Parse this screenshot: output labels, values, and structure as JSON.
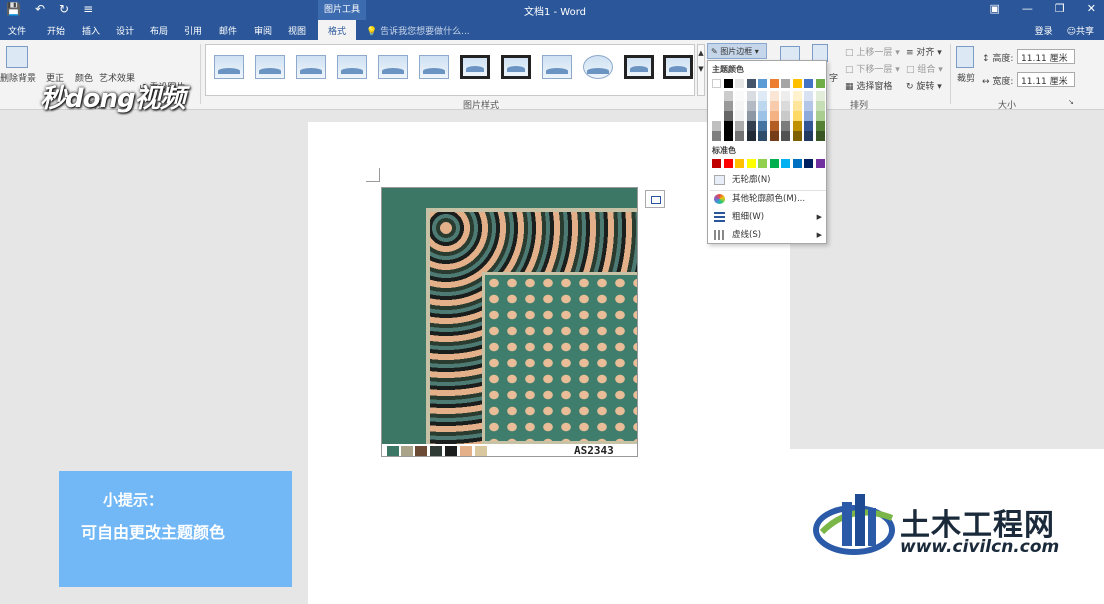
{
  "title_bar": {
    "doc_title": "文档1 - Word",
    "context_tab_group": "图片工具",
    "quick_access": [
      "save-icon",
      "undo-icon",
      "redo-icon",
      "customize-icon"
    ],
    "window_buttons": [
      "ribbon-display-icon",
      "minimize-icon",
      "restore-icon",
      "close-icon"
    ]
  },
  "tabs": [
    {
      "label": "文件"
    },
    {
      "label": "开始"
    },
    {
      "label": "插入"
    },
    {
      "label": "设计"
    },
    {
      "label": "布局"
    },
    {
      "label": "引用"
    },
    {
      "label": "邮件"
    },
    {
      "label": "审阅"
    },
    {
      "label": "视图"
    },
    {
      "label": "格式",
      "active": true
    }
  ],
  "tell_me": "告诉我您想要做什么...",
  "account": {
    "signin": "登录",
    "share": "共享"
  },
  "ribbon": {
    "remove_bg": "删除背景",
    "corrections": "更正",
    "color": "颜色",
    "artistic": "艺术效果",
    "reset_picture": "重设图片",
    "group_adjust": "调整",
    "group_styles": "图片样式",
    "border_button": "图片边框",
    "wrap_text": "字",
    "bring_forward": "上移一层",
    "send_backward": "下移一层",
    "selection_pane": "选择窗格",
    "align": "对齐",
    "group": "组合",
    "rotate": "旋转",
    "group_arrange": "排列",
    "crop": "裁剪",
    "height_label": "高度:",
    "height_value": "11.11 厘米",
    "width_label": "宽度:",
    "width_value": "11.11 厘米",
    "group_size": "大小"
  },
  "watermark_logo": "秒dong视频",
  "dropdown": {
    "theme_colors_label": "主题颜色",
    "standard_colors_label": "标准色",
    "no_outline": "无轮廓(N)",
    "more_colors": "其他轮廓颜色(M)...",
    "weight": "粗细(W)",
    "dashes": "虚线(S)",
    "theme_top": [
      "#ffffff",
      "#000000",
      "#e7e6e6",
      "#44546a",
      "#5b9bd5",
      "#ed7d31",
      "#a5a5a5",
      "#ffc000",
      "#4472c4",
      "#70ad47"
    ],
    "standard_colors": [
      "#c00000",
      "#ff0000",
      "#ffc000",
      "#ffff00",
      "#92d050",
      "#00b050",
      "#00b0f0",
      "#0070c0",
      "#002060",
      "#7030a0"
    ]
  },
  "picture": {
    "code": "AS2343",
    "swatches": [
      "#3c7766",
      "#a9a489",
      "#6b4a36",
      "#2e3a33",
      "#1b1d1c",
      "#e3b08a",
      "#d9c7a0"
    ]
  },
  "tip": {
    "title": "小提示：",
    "body": "可自由更改主题颜色"
  },
  "brand": {
    "cn": "土木工程网",
    "en": "www.civilcn.com"
  }
}
